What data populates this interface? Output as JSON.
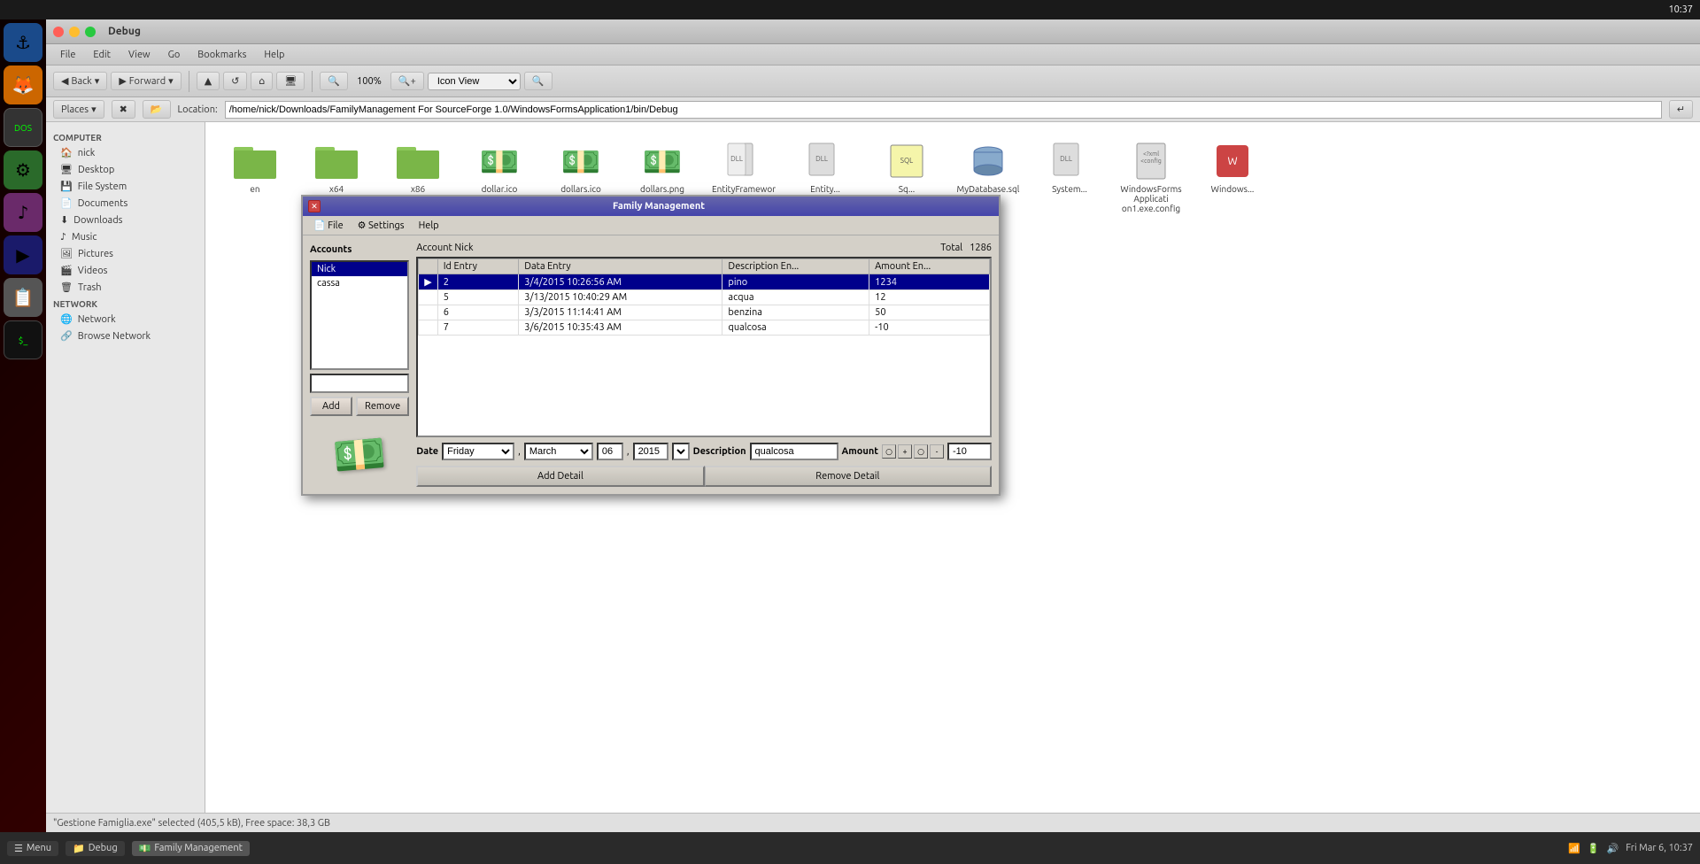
{
  "topbar": {
    "time": "10:37"
  },
  "bottombar": {
    "menu_label": "Menu",
    "items": [
      {
        "label": "Debug",
        "icon": "folder-icon",
        "active": false
      },
      {
        "label": "Family Management",
        "icon": "app-icon",
        "active": true
      }
    ],
    "right_text": "Fri Mar 6, 10:37"
  },
  "file_manager": {
    "title": "Debug",
    "menubar": [
      "File",
      "Edit",
      "View",
      "Go",
      "Bookmarks",
      "Help"
    ],
    "toolbar": {
      "back": "Back",
      "forward": "Forward",
      "zoom": "100%",
      "view": "Icon View"
    },
    "location": {
      "label": "Location:",
      "path": "/home/nick/Downloads/FamilyManagement For SourceForge 1.0/WindowsFormsApplication1/bin/Debug"
    },
    "sidebar": {
      "places_label": "Places",
      "computer_label": "Computer",
      "items_computer": [
        {
          "label": "nick",
          "icon": "home-icon"
        },
        {
          "label": "Desktop",
          "icon": "desktop-icon"
        },
        {
          "label": "File System",
          "icon": "filesystem-icon"
        },
        {
          "label": "Documents",
          "icon": "documents-icon"
        },
        {
          "label": "Downloads",
          "icon": "downloads-icon"
        },
        {
          "label": "Music",
          "icon": "music-icon"
        },
        {
          "label": "Pictures",
          "icon": "pictures-icon"
        },
        {
          "label": "Videos",
          "icon": "videos-icon"
        },
        {
          "label": "Trash",
          "icon": "trash-icon"
        }
      ],
      "network_label": "Network",
      "items_network": [
        {
          "label": "Browse Network",
          "icon": "network-icon"
        }
      ]
    },
    "files": [
      {
        "name": "en",
        "type": "folder"
      },
      {
        "name": "x64",
        "type": "folder"
      },
      {
        "name": "x86",
        "type": "folder"
      },
      {
        "name": "dollar.ico",
        "type": "money"
      },
      {
        "name": "dollars.ico",
        "type": "money"
      },
      {
        "name": "dollars.png",
        "type": "money"
      },
      {
        "name": "EntityFramework.dll",
        "type": "dll"
      },
      {
        "name": "Entity...",
        "type": "dll"
      },
      {
        "name": "Sq...",
        "type": "db"
      },
      {
        "name": "MyDatabase.sqlite",
        "type": "db"
      },
      {
        "name": "System...",
        "type": "dll"
      },
      {
        "name": "WindowsFormsApplicati on1.exe.config",
        "type": "config"
      },
      {
        "name": "Windows...",
        "type": "exe"
      }
    ],
    "status": "\"Gestione Famiglia.exe\" selected (405,5 kB), Free space: 38,3 GB"
  },
  "dialog": {
    "title": "Family Management",
    "menu": [
      "File",
      "Settings",
      "Help"
    ],
    "accounts_label": "Accounts",
    "account_nick_label": "Account Nick",
    "total_label": "Total",
    "total_value": "1286",
    "accounts": [
      {
        "label": "Nick",
        "selected": true
      },
      {
        "label": "cassa",
        "selected": false
      }
    ],
    "table": {
      "columns": [
        "Id Entry",
        "Data Entry",
        "Description En...",
        "Amount En..."
      ],
      "rows": [
        {
          "id": "2",
          "date": "3/4/2015 10:26:56 AM",
          "desc": "pino",
          "amount": "1234",
          "selected": true
        },
        {
          "id": "5",
          "date": "3/13/2015 10:40:29 AM",
          "desc": "acqua",
          "amount": "12",
          "selected": false
        },
        {
          "id": "6",
          "date": "3/3/2015 11:14:41 AM",
          "desc": "benzina",
          "amount": "50",
          "selected": false
        },
        {
          "id": "7",
          "date": "3/6/2015 10:35:43 AM",
          "desc": "qualcosa",
          "amount": "-10",
          "selected": false
        }
      ]
    },
    "detail": {
      "date_label": "Date",
      "day": "Friday",
      "month": "March",
      "day_num": "06",
      "year": "2015",
      "desc_label": "Description",
      "desc_value": "qualcosa",
      "amount_label": "Amount",
      "amount_value": "-10"
    },
    "add_btn": "Add Detail",
    "remove_btn": "Remove Detail",
    "add_account_btn": "Add",
    "remove_account_btn": "Remove"
  }
}
